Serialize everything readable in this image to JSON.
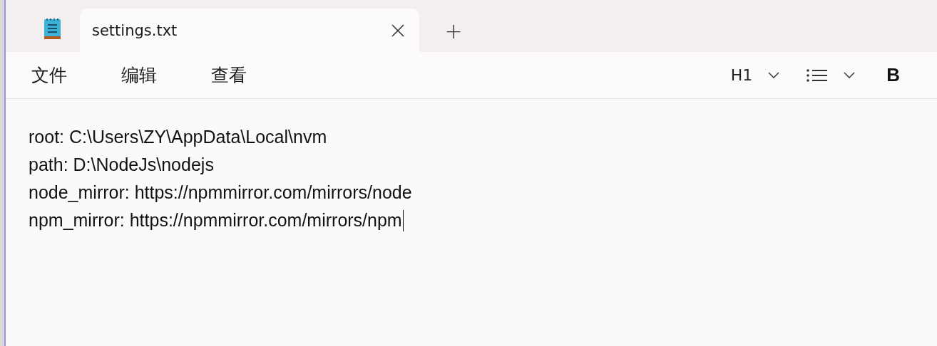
{
  "tabs": [
    {
      "title": "settings.txt",
      "selected": true
    }
  ],
  "new_tab": "+",
  "menu": [
    "文件",
    "编辑",
    "查看"
  ],
  "format_toolbar": {
    "heading": "H1",
    "bold": "B"
  },
  "editor": {
    "lines": [
      "root: C:\\Users\\ZY\\AppData\\Local\\nvm",
      "path: D:\\NodeJs\\nodejs",
      "node_mirror: https://npmmirror.com/mirrors/node",
      "npm_mirror: https://npmmirror.com/mirrors/npm"
    ]
  }
}
